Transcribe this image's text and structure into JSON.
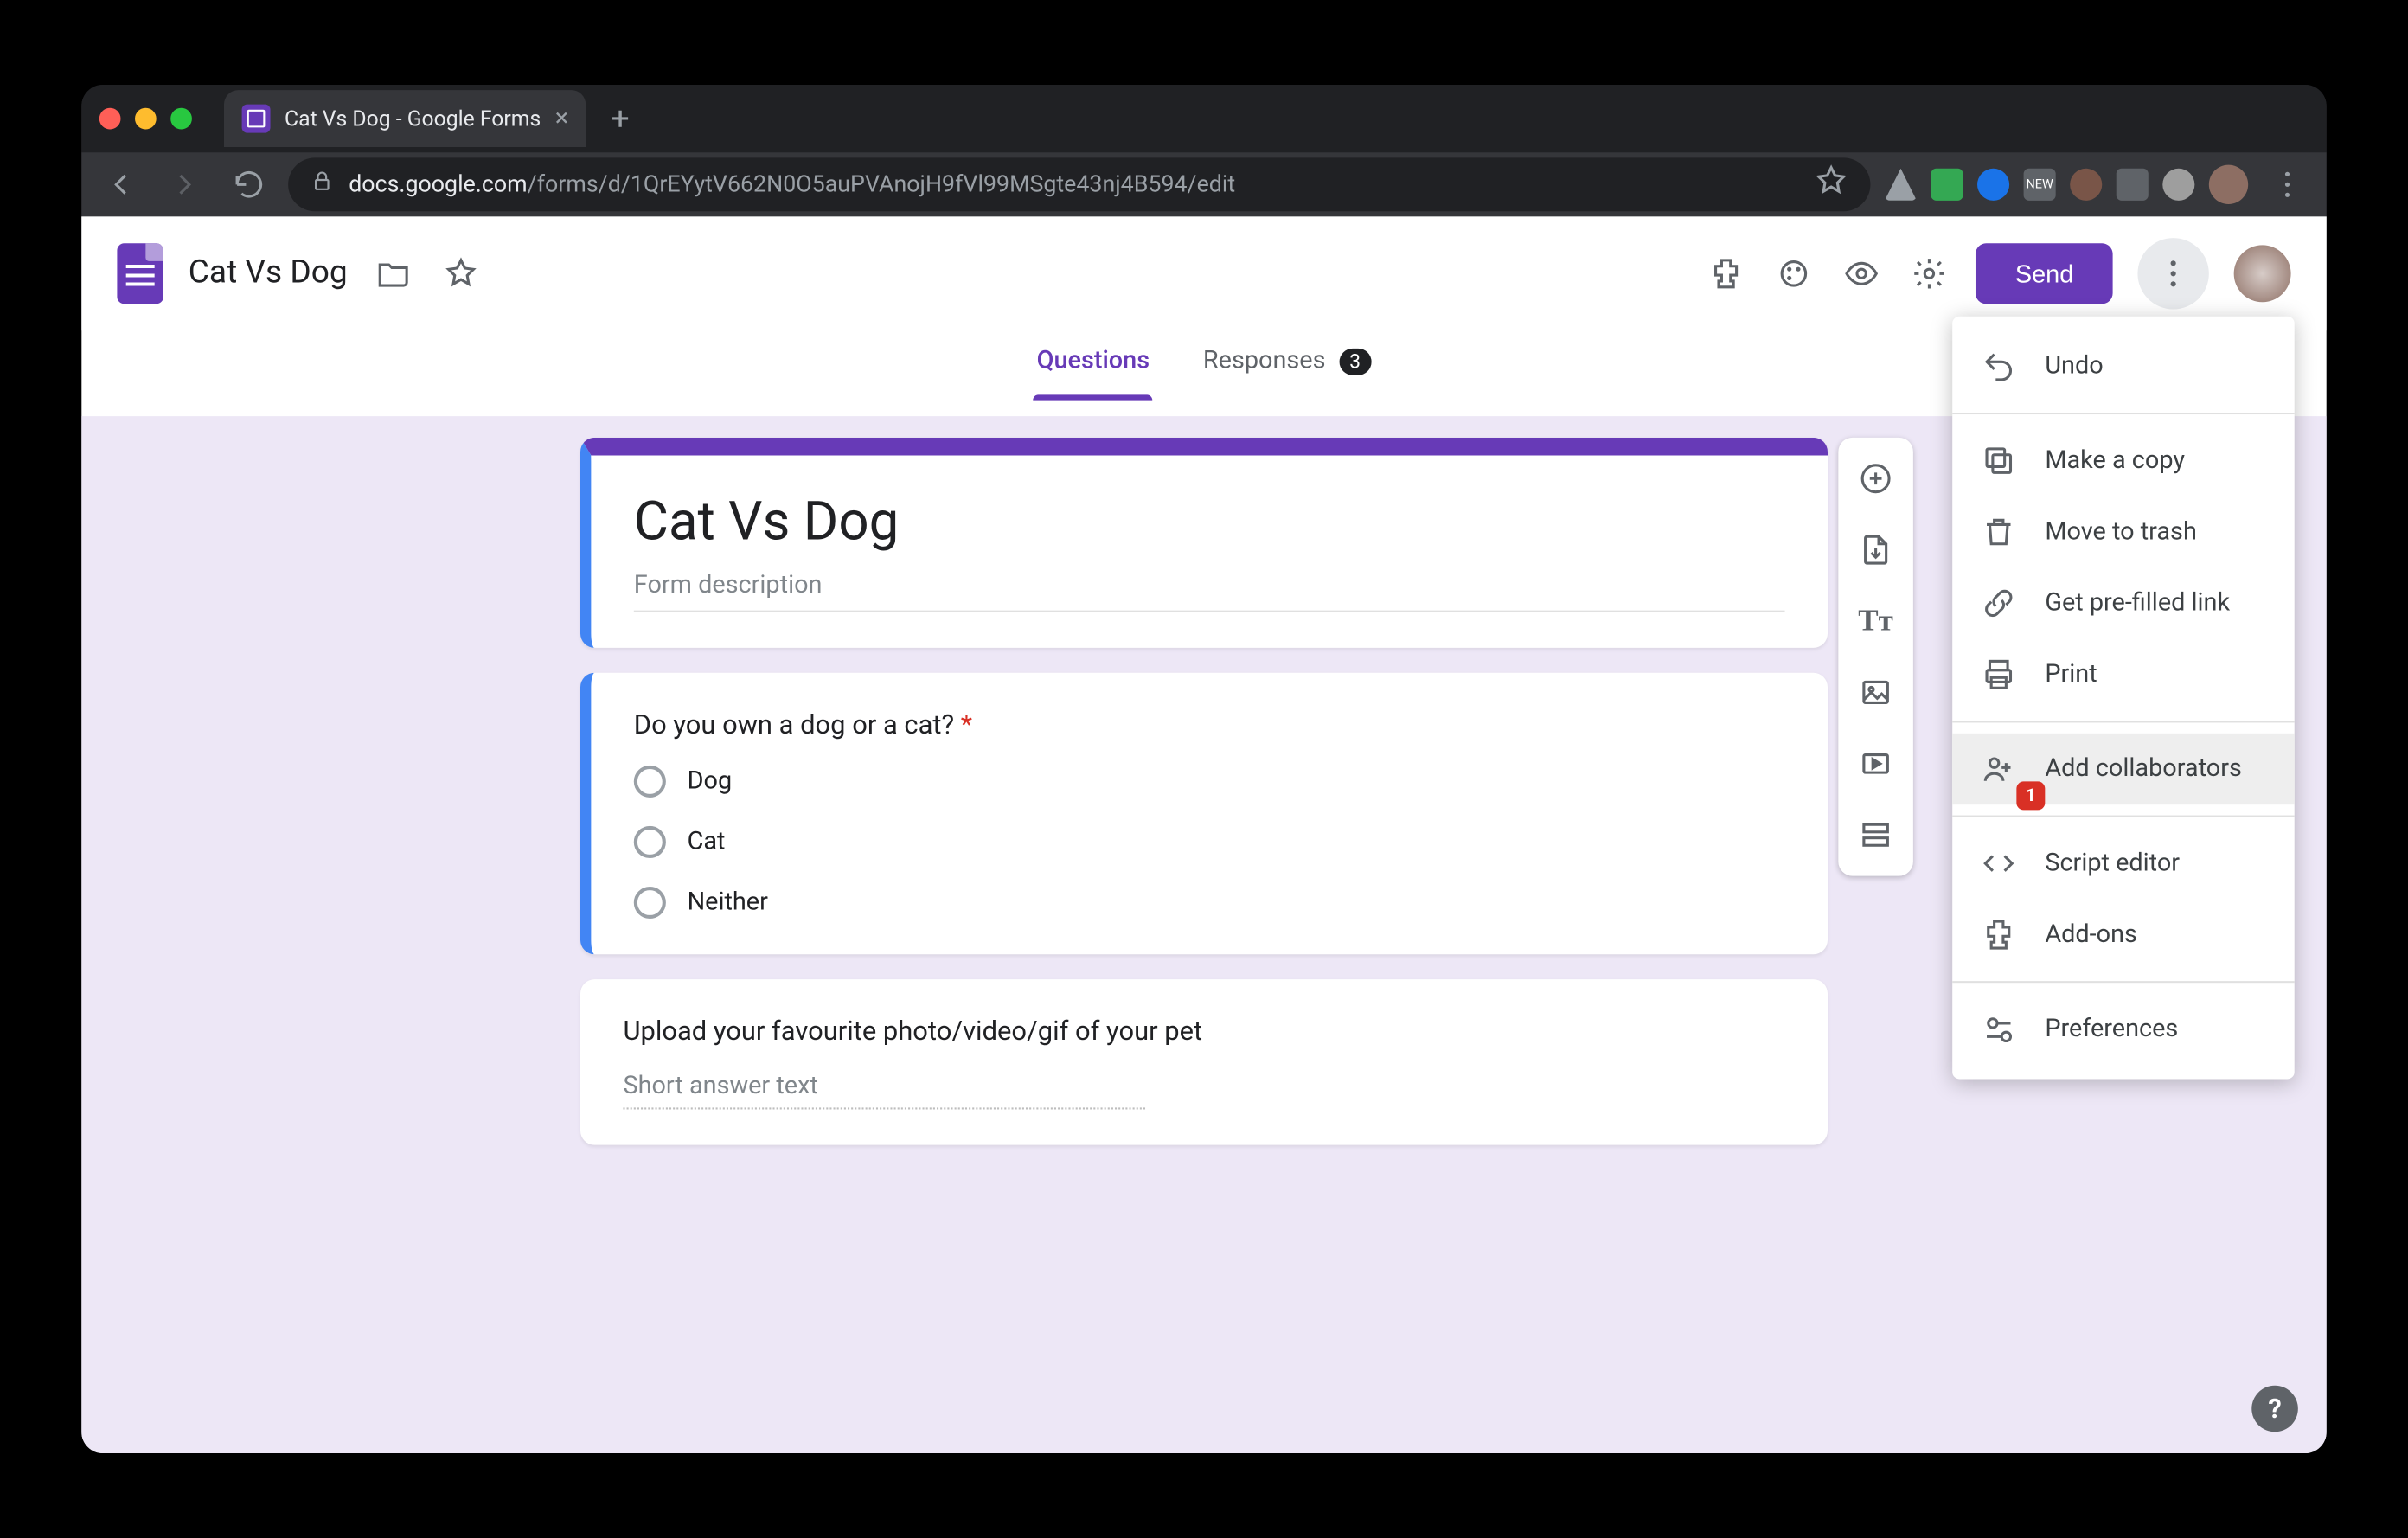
{
  "browser": {
    "tab_title": "Cat Vs Dog - Google Forms",
    "url_host": "docs.google.com",
    "url_path": "/forms/d/1QrEYytV662N0O5auPVAnojH9fVl99MSgte43nj4B594/edit"
  },
  "header": {
    "doc_title": "Cat Vs Dog",
    "send_label": "Send"
  },
  "tabs": {
    "questions": "Questions",
    "responses": "Responses",
    "responses_count": "3"
  },
  "form": {
    "title": "Cat Vs Dog",
    "description_placeholder": "Form description",
    "q1": {
      "title": "Do you own a dog or a cat?",
      "required_mark": "*",
      "options": [
        "Dog",
        "Cat",
        "Neither"
      ]
    },
    "q2": {
      "title": "Upload your favourite photo/video/gif of your pet",
      "placeholder": "Short answer text"
    }
  },
  "menu": {
    "undo": "Undo",
    "copy": "Make a copy",
    "trash": "Move to trash",
    "prefilled": "Get pre-filled link",
    "print": "Print",
    "collab": "Add collaborators",
    "collab_badge": "1",
    "script": "Script editor",
    "addons": "Add-ons",
    "prefs": "Preferences"
  },
  "help": "?"
}
